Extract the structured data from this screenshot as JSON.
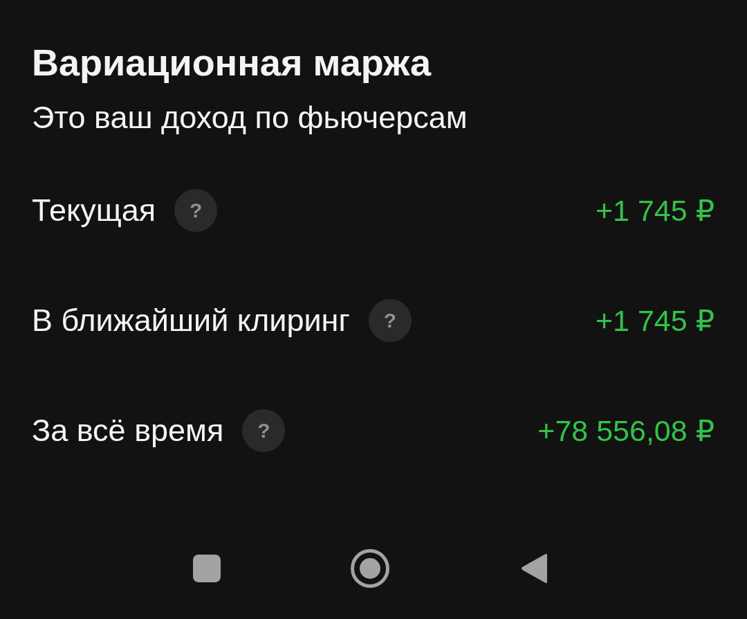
{
  "header": {
    "title": "Вариационная маржа",
    "subtitle": "Это ваш доход по фьючерсам"
  },
  "rows": [
    {
      "label": "Текущая",
      "hint": "?",
      "value": "+1 745 ₽"
    },
    {
      "label": "В ближайший клиринг",
      "hint": "?",
      "value": "+1 745 ₽"
    },
    {
      "label": "За всё время",
      "hint": "?",
      "value": "+78 556,08 ₽"
    }
  ],
  "nav_bar": {
    "buttons": [
      {
        "kind": "recents"
      },
      {
        "kind": "home"
      },
      {
        "kind": "back"
      }
    ]
  }
}
